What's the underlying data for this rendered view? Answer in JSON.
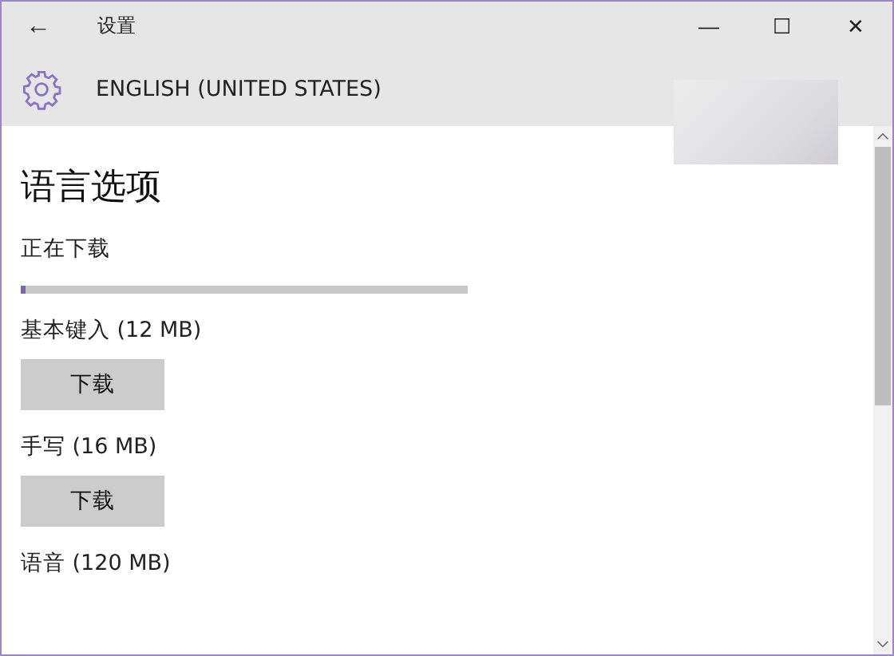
{
  "window": {
    "title": "设置",
    "back": "←",
    "controls": [
      "—",
      "☐",
      "✕"
    ]
  },
  "header": {
    "title": "ENGLISH (UNITED STATES)"
  },
  "page": {
    "heading": "语言选项",
    "download": {
      "label": "正在下载",
      "level": 0.01
    },
    "features": [
      {
        "label": "基本键入 (12 MB)",
        "button": "下载"
      },
      {
        "label": "手写 (16 MB)",
        "button": "下载"
      },
      {
        "label": "语音 (120 MB)"
      }
    ]
  }
}
